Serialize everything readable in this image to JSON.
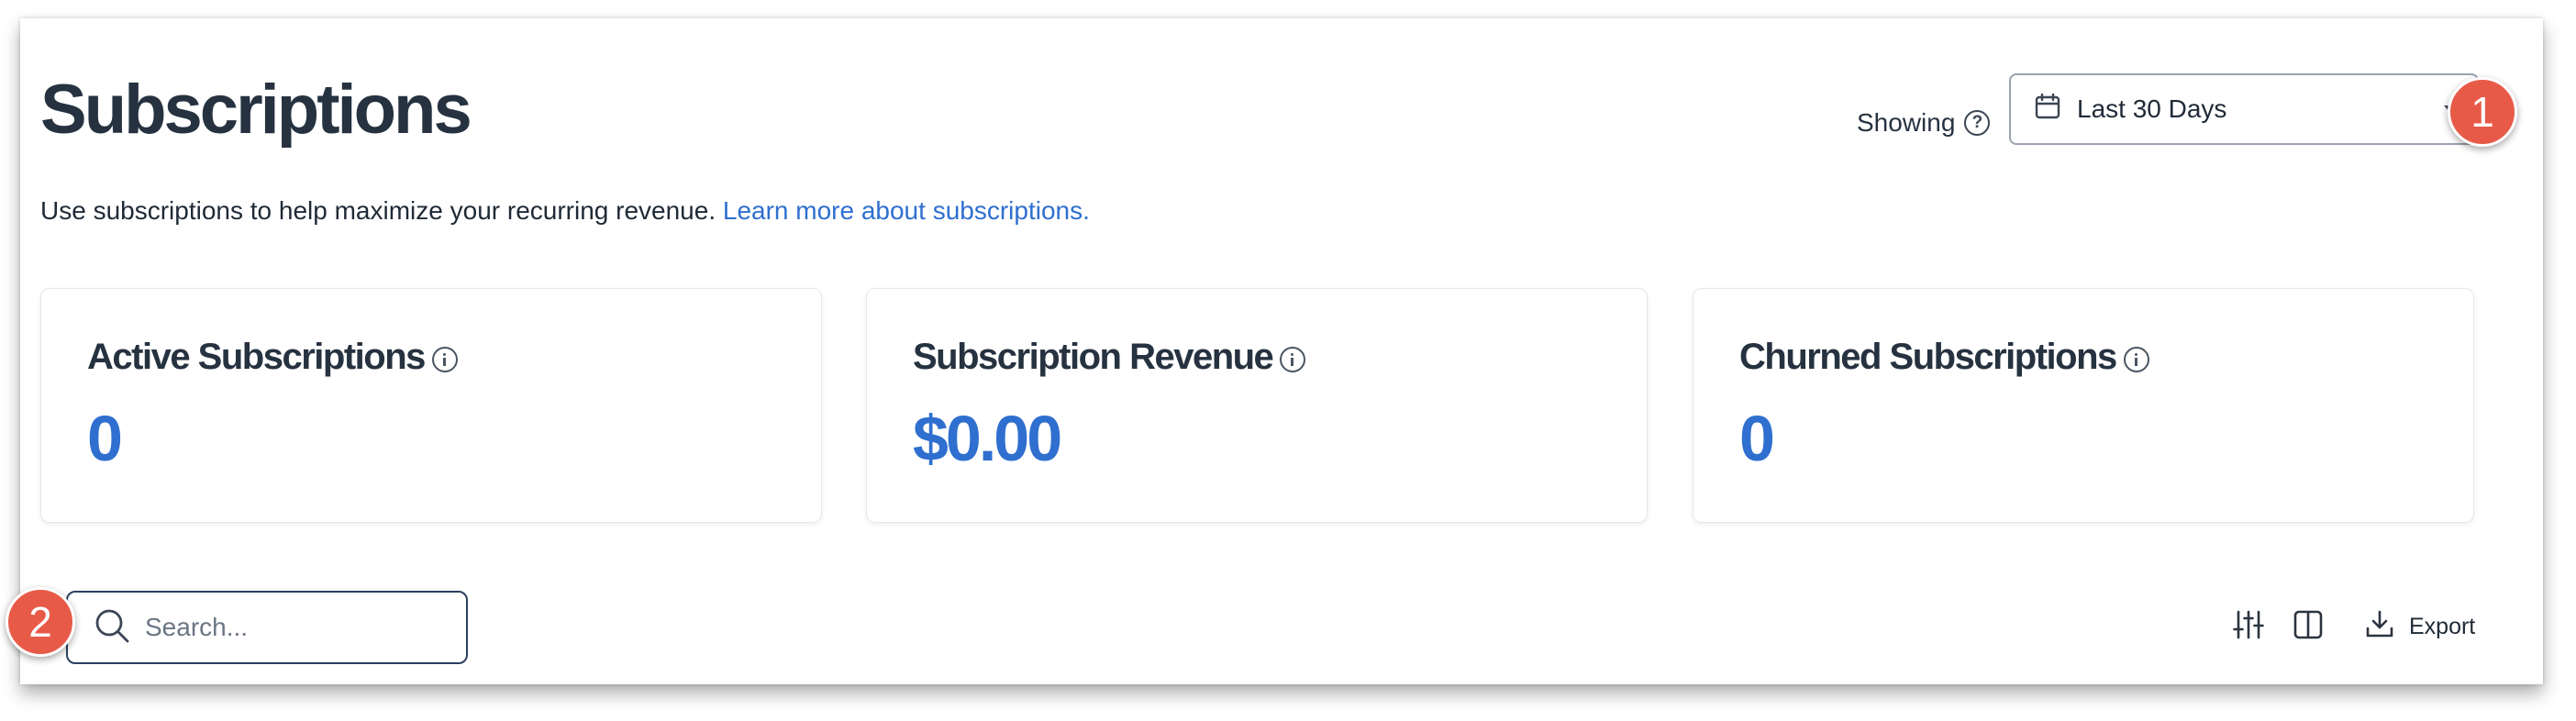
{
  "header": {
    "title": "Subscriptions",
    "description": "Use subscriptions to help maximize your recurring revenue.",
    "learn_more_link": "Learn more about subscriptions."
  },
  "date_filter": {
    "showing_label": "Showing",
    "selected_range": "Last 30 Days",
    "help_glyph": "?"
  },
  "stats": [
    {
      "label": "Active Subscriptions",
      "value": "0"
    },
    {
      "label": "Subscription Revenue",
      "value": "$0.00"
    },
    {
      "label": "Churned Subscriptions",
      "value": "0"
    }
  ],
  "search": {
    "placeholder": "Search...",
    "value": ""
  },
  "toolbar": {
    "export_label": "Export",
    "icons": [
      "filter-sliders-icon",
      "columns-icon",
      "download-icon"
    ]
  },
  "callouts": {
    "badge_1": "1",
    "badge_2": "2",
    "color": "#e85a48"
  },
  "colors": {
    "accent": "#2f6fcf",
    "text": "#263240"
  }
}
